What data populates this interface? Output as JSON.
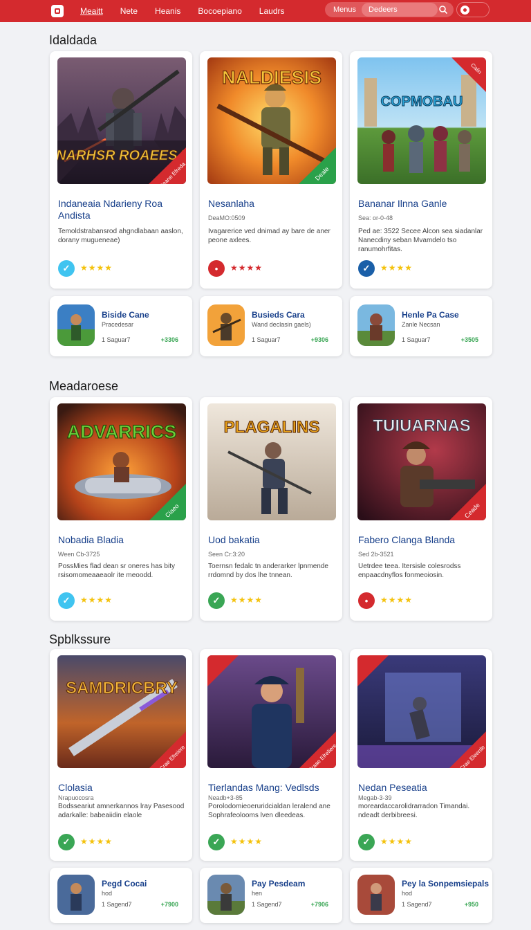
{
  "nav": {
    "links": [
      "Meaitt",
      "Nete",
      "Heanis",
      "Bocoepiano",
      "Laudrs"
    ],
    "menus_label": "Menus",
    "search_placeholder": "Dedeers"
  },
  "sections": [
    {
      "title": "Idaldada",
      "cards": [
        {
          "title": "Indaneaia Ndarieny Roa Andista",
          "meta": "",
          "desc": "Temoldstrabansrod ahgndlabaan aaslon, dorany mugueneae)",
          "badge": "check",
          "badge_color": "#40c4f0",
          "stars": "★★★★",
          "art_text": "NARHSR ROAEESA",
          "ribbon": "Ceane Efreda"
        },
        {
          "title": "Nesanlaha",
          "meta": "DeaMO:0509",
          "desc": "Ivagarerice ved dnimad ay bare de aner peone axlees.",
          "badge": "dot",
          "badge_color": "#d42a2e",
          "stars": "★★★★",
          "art_text": "NALDIESIS",
          "ribbon": "Deale"
        },
        {
          "title": "Bananar Ilnna Ganle",
          "meta": "Sea: or-0-48",
          "desc": "Ped ae: 3522 Secee Alcon sea siadanlar Nanecdiny seban Mvamdelo tso ranumohrfitas.",
          "badge": "check",
          "badge_color": "#1a5fa8",
          "stars": "★★★★",
          "art_text": "COPMOBAU",
          "ribbon": "Calin"
        }
      ],
      "minis": [
        {
          "title": "Biside Cane",
          "sub": "Pracedesar",
          "count": "1 Saguar7",
          "price": "+3306"
        },
        {
          "title": "Busieds Cara",
          "sub": "Wand declasin gaels)",
          "count": "1 Saguar7",
          "price": "+9306"
        },
        {
          "title": "Henle Pa Case",
          "sub": "Zanle Necsan",
          "count": "1 Saguar7",
          "price": "+3505"
        }
      ]
    },
    {
      "title": "Meadaroese",
      "cards": [
        {
          "title": "Nobadia Bladia",
          "meta": "Ween Cb-3725",
          "desc": "PossMies flad dean sr oneres has bity rsisomomeaaeaolr ite meoodd.",
          "badge": "check",
          "badge_color": "#40c4f0",
          "stars": "★★★★",
          "art_text": "ADVARRICS",
          "ribbon": "Ciaeo"
        },
        {
          "title": "Uod bakatia",
          "meta": "Seen Cr:3:20",
          "desc": "Toernsn fedalc tn anderarker lpnmende rrdomnd by dos lhe tnnean.",
          "badge": "check",
          "badge_color": "#3aa655",
          "stars": "★★★★",
          "art_text": "PLAGALINS",
          "ribbon": ""
        },
        {
          "title": "Fabero Clanga Blanda",
          "meta": "Sed 2b-3521",
          "desc": "Uetrdee teea. Itersisle colesrodss enpaacdnyflos fonmeoiosin.",
          "badge": "dot",
          "badge_color": "#d42a2e",
          "stars": "★★★★",
          "art_text": "TUIUARNAS",
          "ribbon": "Ceade"
        }
      ],
      "minis": []
    },
    {
      "title": "Spblkssure",
      "cards": [
        {
          "title": "Clolasia",
          "meta": "Nrapuocosra",
          "desc": "Bodsseariut amnerkannos lray Pasesood adarkalle: babeaiidin elaole",
          "badge": "check",
          "badge_color": "#3aa655",
          "stars": "★★★★",
          "art_text": "SAMDRICBRY",
          "ribbon": "Crae Efreiere"
        },
        {
          "title": "Tierlandas Mang: Vedlsds",
          "meta": "Neadb+3-85",
          "desc": "Porolodomieoeruridcialdan leralend ane Sophrafeolooms lven dleedeas.",
          "badge": "check",
          "badge_color": "#3aa655",
          "stars": "★★★★",
          "art_text": "",
          "ribbon": "Craae Efreliere"
        },
        {
          "title": "Nedan Peseatia",
          "meta": "Megab-3-39",
          "desc": "moreardaccarolidrarradon Timandai. ndeadt derbibreesi.",
          "badge": "check",
          "badge_color": "#3aa655",
          "stars": "★★★★",
          "art_text": "",
          "ribbon": "Crae Eleerde"
        }
      ],
      "minis": [
        {
          "title": "Pegd Cocai",
          "sub": "hod",
          "count": "1 Sagend7",
          "price": "+7900"
        },
        {
          "title": "Pay Pesdeam",
          "sub": "hen",
          "count": "1 Sagend7",
          "price": "+7906"
        },
        {
          "title": "Pey la Sonpemsiepals",
          "sub": "hod",
          "count": "1 Sagend7",
          "price": "+950"
        }
      ]
    }
  ],
  "colors": {
    "brand_red": "#d42a2e",
    "title_blue": "#173f8a",
    "star_yellow": "#f4c20d",
    "price_green": "#3aa655"
  }
}
